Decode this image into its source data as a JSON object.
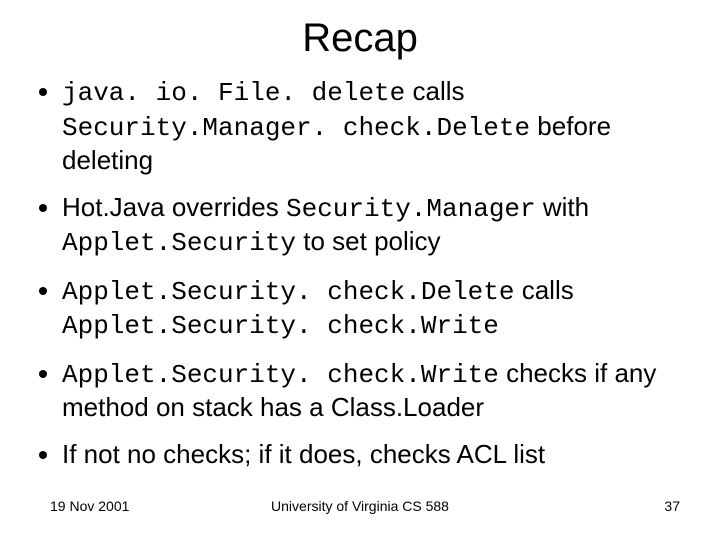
{
  "title": "Recap",
  "bullets": {
    "b1": {
      "c1": "java. io. File. delete",
      "t1": " calls ",
      "c2": "Security.Manager. check.Delete",
      "t2": " before deleting"
    },
    "b2": {
      "t1": "Hot.Java overrides ",
      "c1": "Security.Manager",
      "t2": " with ",
      "c2": "Applet.Security",
      "t3": " to set policy"
    },
    "b3": {
      "c1": "Applet.Security. check.Delete",
      "t1": " calls ",
      "c2": "Applet.Security. check.Write"
    },
    "b4": {
      "c1": "Applet.Security. check.Write",
      "t1": " checks if any method on stack has a Class.Loader"
    },
    "b5": {
      "t1": "If not no checks; if it does, checks ACL list"
    }
  },
  "footer": {
    "date": "19 Nov 2001",
    "center": "University of Virginia CS 588",
    "page": "37"
  }
}
